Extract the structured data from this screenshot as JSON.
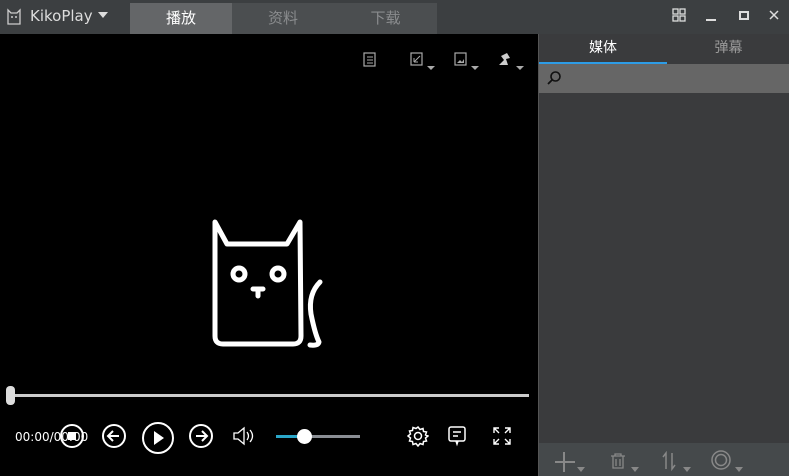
{
  "app": {
    "name": "KikoPlay"
  },
  "tabs": [
    {
      "label": "播放",
      "active": true
    },
    {
      "label": "资料",
      "active": false
    },
    {
      "label": "下载",
      "active": false
    }
  ],
  "window_controls": [
    "grid-icon",
    "minimize-icon",
    "maximize-icon",
    "close-icon"
  ],
  "player": {
    "time": "00:00/00:00",
    "progress": 0,
    "volume": 0.35
  },
  "side": {
    "tabs": [
      {
        "label": "媒体",
        "active": true
      },
      {
        "label": "弹幕",
        "active": false
      }
    ],
    "search_placeholder": ""
  },
  "colors": {
    "accent": "#2d9ce6",
    "volume_fill": "#2aa6c8"
  }
}
